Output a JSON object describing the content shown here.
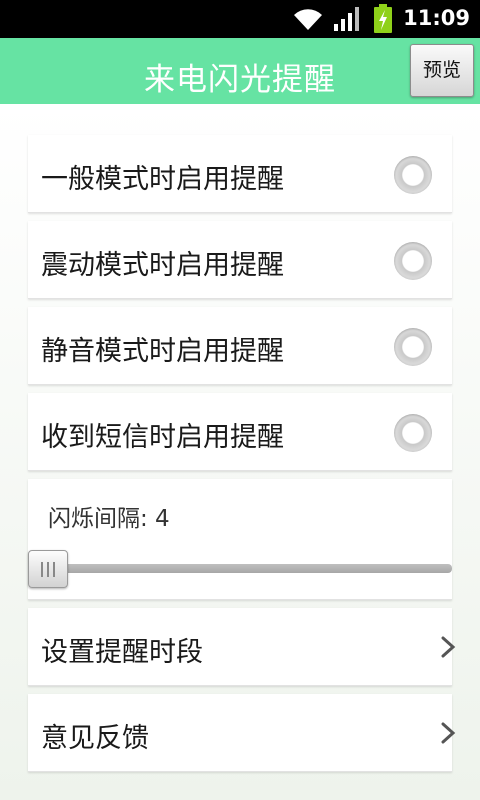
{
  "status_bar": {
    "time": "11:09",
    "icons": [
      "wifi-icon",
      "signal-icon",
      "battery-charging-icon"
    ],
    "battery_color": "#8fd11a"
  },
  "header": {
    "title": "来电闪光提醒",
    "preview_label": "预览",
    "color": "#66e3a3"
  },
  "settings": {
    "toggles": [
      {
        "label": "一般模式时启用提醒",
        "checked": false
      },
      {
        "label": "震动模式时启用提醒",
        "checked": false
      },
      {
        "label": "静音模式时启用提醒",
        "checked": false
      },
      {
        "label": "收到短信时启用提醒",
        "checked": false
      }
    ],
    "flash_interval": {
      "label": "闪烁间隔: 4",
      "value_fraction": 0.0
    },
    "links": [
      {
        "label": "设置提醒时段",
        "icon": "chevron-right-icon"
      },
      {
        "label": "意见反馈",
        "icon": "chevron-right-icon"
      }
    ]
  }
}
